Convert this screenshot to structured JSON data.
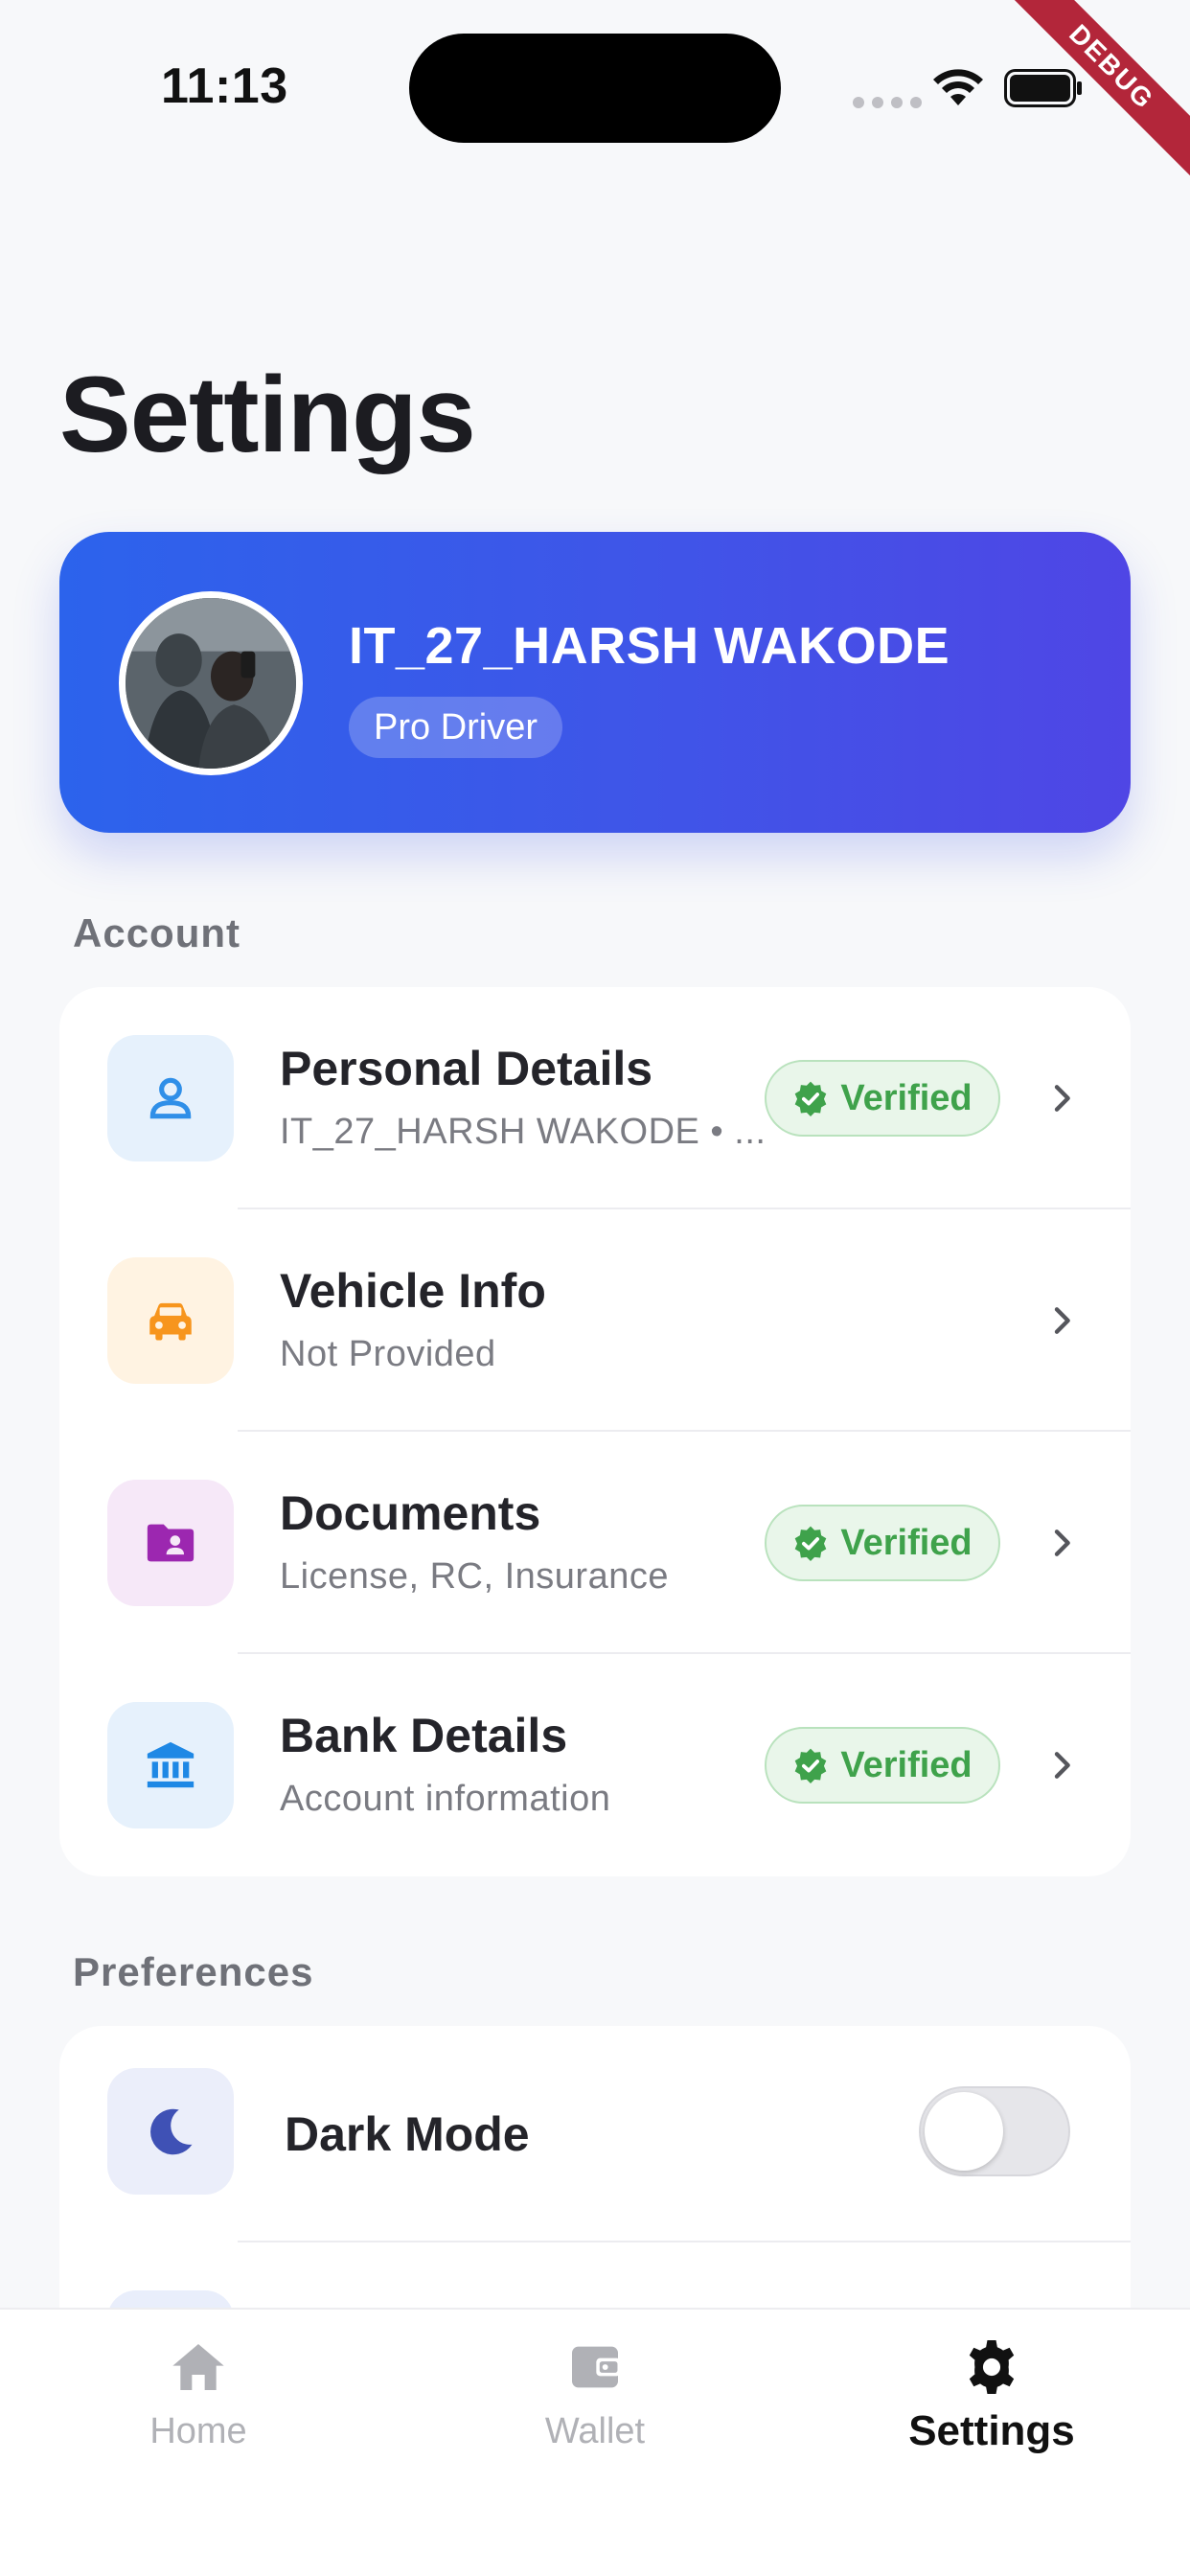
{
  "status_bar": {
    "time": "11:13",
    "debug_label": "DEBUG"
  },
  "page": {
    "title": "Settings"
  },
  "profile": {
    "name": "IT_27_HARSH WAKODE",
    "badge": "Pro Driver"
  },
  "sections": {
    "account_label": "Account",
    "preferences_label": "Preferences"
  },
  "account_items": [
    {
      "title": "Personal Details",
      "subtitle": "IT_27_HARSH WAKODE • ...",
      "badge": "Verified",
      "icon": "person-icon",
      "icon_bg": "#e6f1fc",
      "icon_color": "#2f8fe8"
    },
    {
      "title": "Vehicle Info",
      "subtitle": "Not Provided",
      "badge": "",
      "icon": "car-icon",
      "icon_bg": "#fff3e2",
      "icon_color": "#f7951d"
    },
    {
      "title": "Documents",
      "subtitle": "License, RC, Insurance",
      "badge": "Verified",
      "icon": "id-folder-icon",
      "icon_bg": "#f6e8f8",
      "icon_color": "#9c27b0"
    },
    {
      "title": "Bank Details",
      "subtitle": "Account information",
      "badge": "Verified",
      "icon": "bank-icon",
      "icon_bg": "#e6f1fc",
      "icon_color": "#1e88e5"
    }
  ],
  "preferences_items": [
    {
      "title": "Dark Mode",
      "toggle_on": false,
      "icon": "moon-icon",
      "icon_bg": "#ebeefa",
      "icon_color": "#3f51b5"
    }
  ],
  "bottom_nav": [
    {
      "label": "Home",
      "icon": "home-icon",
      "active": false
    },
    {
      "label": "Wallet",
      "icon": "wallet-icon",
      "active": false
    },
    {
      "label": "Settings",
      "icon": "gear-icon",
      "active": true
    }
  ],
  "colors": {
    "verified_green": "#3fa24b",
    "card_gradient_start": "#2c63ec",
    "card_gradient_end": "#4f46e5"
  }
}
